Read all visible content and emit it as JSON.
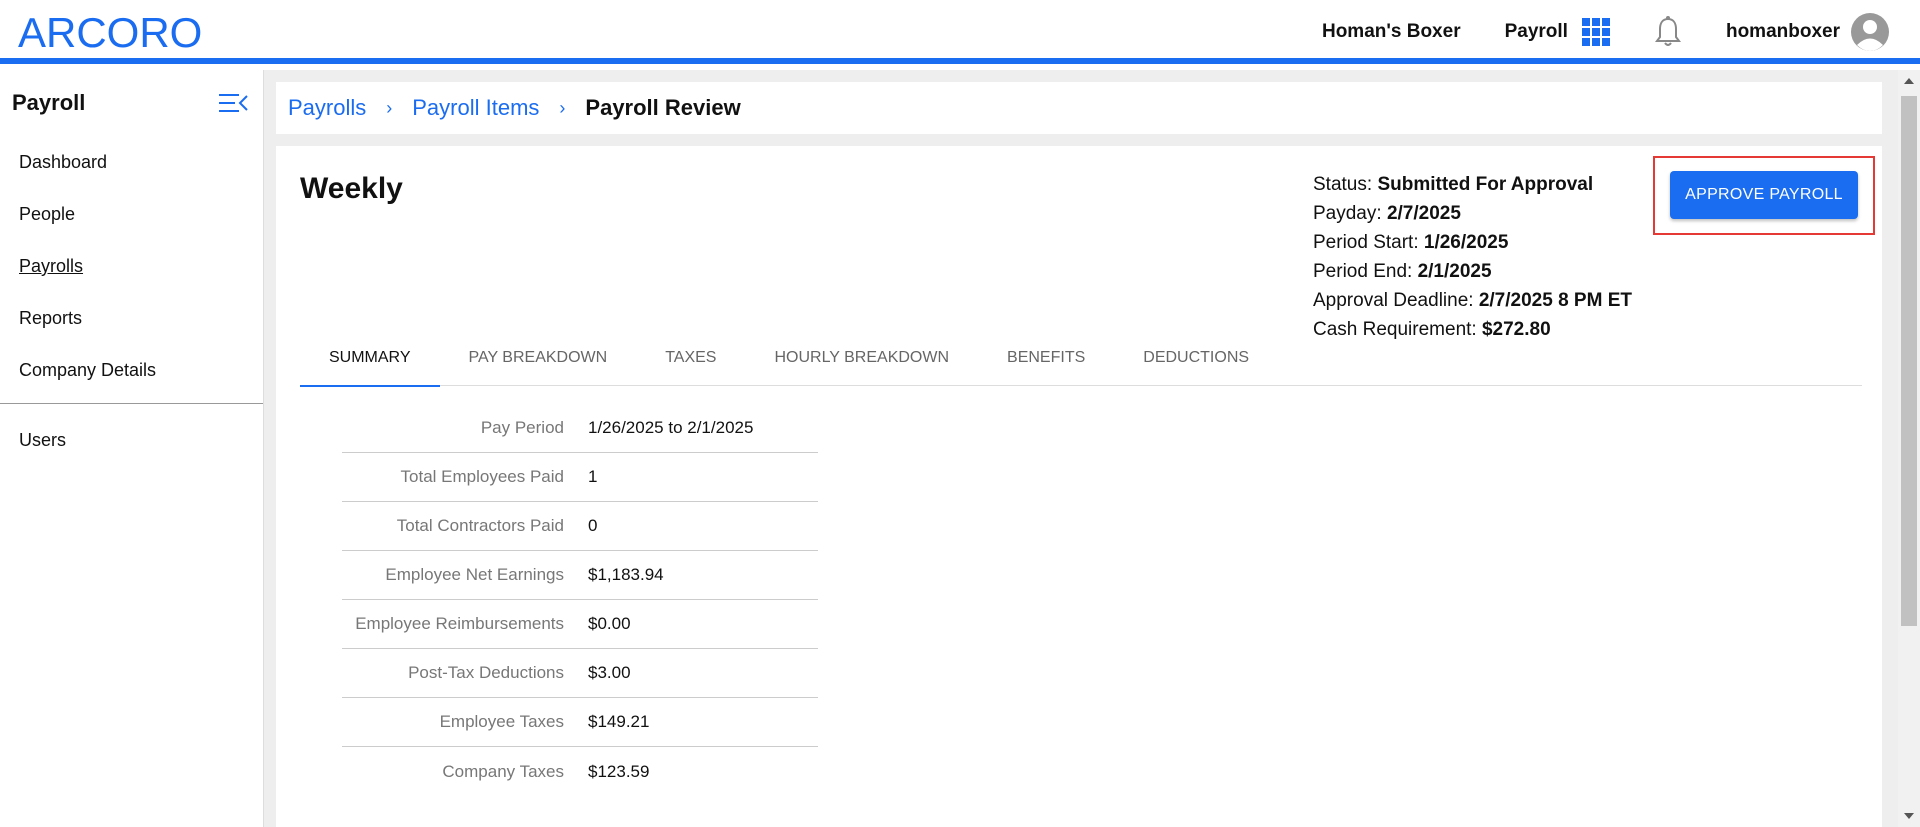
{
  "header": {
    "logo_text": "ARCORO",
    "company_name": "Homan's Boxer",
    "app_name": "Payroll",
    "username": "homanboxer"
  },
  "sidebar": {
    "title": "Payroll",
    "items": [
      {
        "label": "Dashboard"
      },
      {
        "label": "People"
      },
      {
        "label": "Payrolls"
      },
      {
        "label": "Reports"
      },
      {
        "label": "Company Details"
      }
    ],
    "secondary_items": [
      {
        "label": "Users"
      }
    ]
  },
  "breadcrumb": {
    "items": [
      "Payrolls",
      "Payroll Items"
    ],
    "current": "Payroll Review",
    "separator": "›"
  },
  "payroll": {
    "name": "Weekly",
    "status_label": "Status:",
    "status_value": "Submitted For Approval",
    "payday_label": "Payday:",
    "payday_value": "2/7/2025",
    "period_start_label": "Period Start:",
    "period_start_value": "1/26/2025",
    "period_end_label": "Period End:",
    "period_end_value": "2/1/2025",
    "deadline_label": "Approval Deadline:",
    "deadline_value": "2/7/2025 8 PM ET",
    "cash_label": "Cash Requirement:",
    "cash_value": "$272.80",
    "approve_button": "APPROVE PAYROLL"
  },
  "tabs": [
    {
      "label": "SUMMARY"
    },
    {
      "label": "PAY BREAKDOWN"
    },
    {
      "label": "TAXES"
    },
    {
      "label": "HOURLY BREAKDOWN"
    },
    {
      "label": "BENEFITS"
    },
    {
      "label": "DEDUCTIONS"
    }
  ],
  "summary": [
    {
      "label": "Pay Period",
      "value": "1/26/2025 to 2/1/2025"
    },
    {
      "label": "Total Employees Paid",
      "value": "1"
    },
    {
      "label": "Total Contractors Paid",
      "value": "0"
    },
    {
      "label": "Employee Net Earnings",
      "value": "$1,183.94"
    },
    {
      "label": "Employee Reimbursements",
      "value": "$0.00"
    },
    {
      "label": "Post-Tax Deductions",
      "value": "$3.00"
    },
    {
      "label": "Employee Taxes",
      "value": "$149.21"
    },
    {
      "label": "Company Taxes",
      "value": "$123.59"
    }
  ],
  "colors": {
    "accent": "#1a6cf0",
    "highlight_border": "#e53935"
  },
  "icons": [
    "apps-grid-icon",
    "bell-icon",
    "avatar-icon",
    "sidebar-collapse-icon"
  ]
}
